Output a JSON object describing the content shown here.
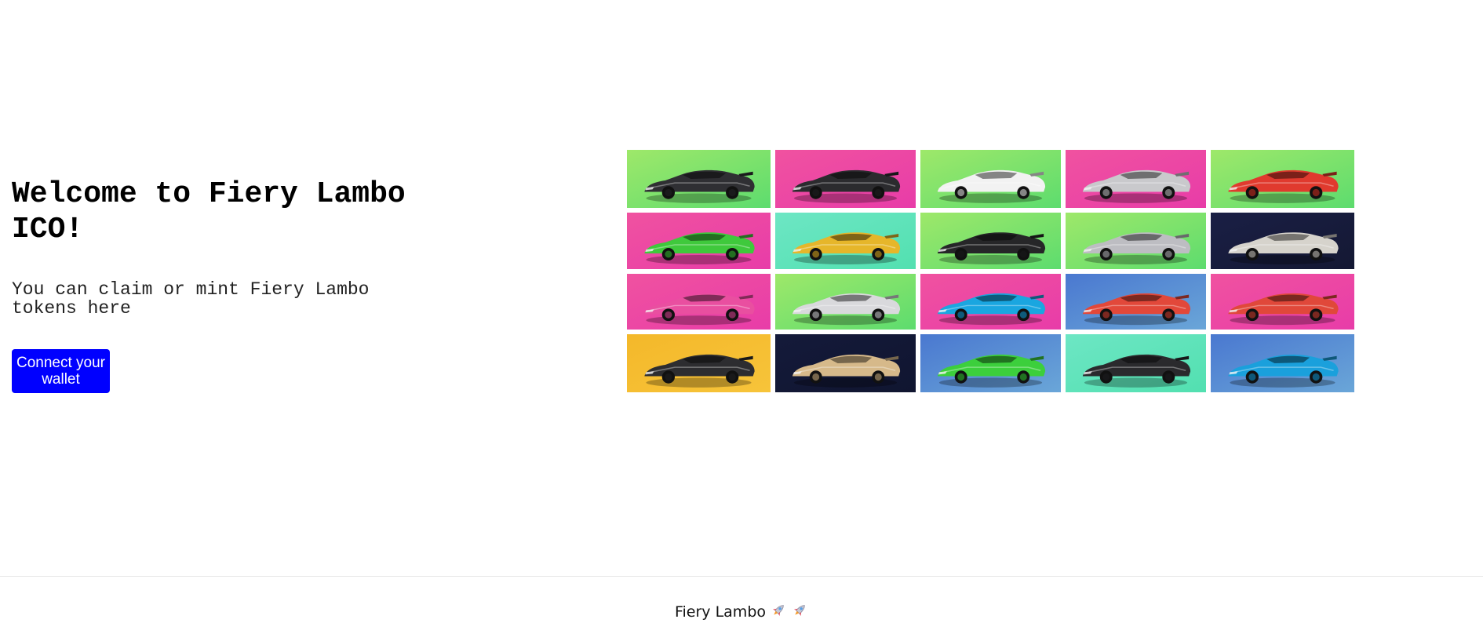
{
  "hero": {
    "title": "Welcome to Fiery Lambo ICO!",
    "subtitle": "You can claim or mint Fiery Lambo tokens here",
    "connect_label": "Connect your wallet",
    "accent_color": "#0000ff"
  },
  "gallery": {
    "tiles": [
      {
        "bg": [
          "#9ee86a",
          "#5ddc6e"
        ],
        "car": "#2f2f33"
      },
      {
        "bg": [
          "#f052a0",
          "#e83ca8"
        ],
        "car": "#2b2b2e"
      },
      {
        "bg": [
          "#9ee86a",
          "#5ddc6e"
        ],
        "car": "#f2f2f2"
      },
      {
        "bg": [
          "#f052a0",
          "#e83ca8"
        ],
        "car": "#c9c9cc"
      },
      {
        "bg": [
          "#9ee86a",
          "#5ddc6e"
        ],
        "car": "#e03a2e"
      },
      {
        "bg": [
          "#f052a0",
          "#e83ca8"
        ],
        "car": "#3fc93c"
      },
      {
        "bg": [
          "#6de6c4",
          "#52e0b0"
        ],
        "car": "#e6b62a"
      },
      {
        "bg": [
          "#9ee86a",
          "#5ddc6e"
        ],
        "car": "#262628"
      },
      {
        "bg": [
          "#9ee86a",
          "#5ddc6e"
        ],
        "car": "#bdbdc2"
      },
      {
        "bg": [
          "#1a1f45",
          "#141833"
        ],
        "car": "#d6d3cc"
      },
      {
        "bg": [
          "#f052a0",
          "#e83ca8"
        ],
        "car": "#e94fa0"
      },
      {
        "bg": [
          "#9ee86a",
          "#5ddc6e"
        ],
        "car": "#d9d9dc"
      },
      {
        "bg": [
          "#f052a0",
          "#e83ca8"
        ],
        "car": "#1aa6e0"
      },
      {
        "bg": [
          "#4a78d0",
          "#6aa6d8"
        ],
        "car": "#e2483a"
      },
      {
        "bg": [
          "#f052a0",
          "#e83ca8"
        ],
        "car": "#e0483a"
      },
      {
        "bg": [
          "#f4b82a",
          "#f7c43a"
        ],
        "car": "#2d2d30"
      },
      {
        "bg": [
          "#141a3a",
          "#101530"
        ],
        "car": "#d6b98a"
      },
      {
        "bg": [
          "#4a78d0",
          "#6aa6d8"
        ],
        "car": "#3ccf3c"
      },
      {
        "bg": [
          "#6de6c4",
          "#52e0b0"
        ],
        "car": "#2a2a2d"
      },
      {
        "bg": [
          "#4a78d0",
          "#6aa6d8"
        ],
        "car": "#1aa0dc"
      }
    ]
  },
  "footer": {
    "text": "Fiery Lambo",
    "icons": [
      "rocket-icon",
      "rocket-icon"
    ]
  }
}
